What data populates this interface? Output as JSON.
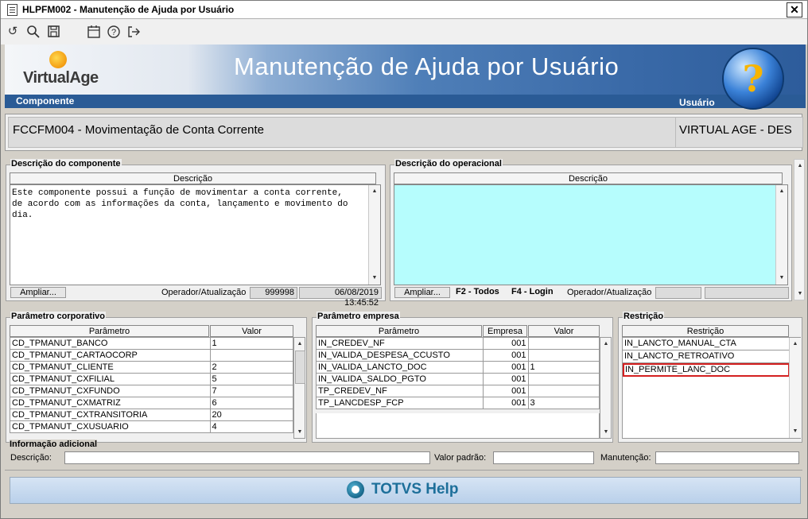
{
  "window": {
    "title": "HLPFM002 - Manutenção de Ajuda por Usuário",
    "close": "✕"
  },
  "toolbar": {
    "icons": [
      "undo-icon",
      "search-icon",
      "save-icon",
      "calendar-icon",
      "help-icon",
      "exit-icon"
    ]
  },
  "banner": {
    "logo_text": "VirtualAge",
    "title": "Manutenção de Ajuda por Usuário",
    "left_label": "Componente",
    "right_label": "Usuário",
    "help_glyph": "?"
  },
  "component": {
    "name": "FCCFM004 - Movimentação de Conta Corrente",
    "user": "VIRTUAL AGE - DES"
  },
  "comp_desc": {
    "legend": "Descrição do componente",
    "header": "Descrição",
    "lines": [
      "Este componente possui a função de movimentar a conta corrente,",
      "de acordo com as informações da conta, lançamento e movimento do",
      "dia."
    ],
    "expand_button": "Ampliar...",
    "operator_label": "Operador/Atualização",
    "operator": "999998",
    "updated": "06/08/2019 13:45:52"
  },
  "op_desc": {
    "legend": "Descrição do operacional",
    "header": "Descrição",
    "expand_button": "Ampliar...",
    "f2": "F2 - Todos",
    "f4": "F4 - Login",
    "operator_label": "Operador/Atualização",
    "operator": "",
    "updated": ""
  },
  "corp_params": {
    "legend": "Parâmetro corporativo",
    "headers": [
      "Parâmetro",
      "Valor"
    ],
    "rows": [
      [
        "CD_TPMANUT_BANCO",
        "1"
      ],
      [
        "CD_TPMANUT_CARTAOCORP",
        ""
      ],
      [
        "CD_TPMANUT_CLIENTE",
        "2"
      ],
      [
        "CD_TPMANUT_CXFILIAL",
        "5"
      ],
      [
        "CD_TPMANUT_CXFUNDO",
        "7"
      ],
      [
        "CD_TPMANUT_CXMATRIZ",
        "6"
      ],
      [
        "CD_TPMANUT_CXTRANSITORIA",
        "20"
      ],
      [
        "CD_TPMANUT_CXUSUARIO",
        "4"
      ]
    ]
  },
  "company_params": {
    "legend": "Parâmetro empresa",
    "headers": [
      "Parâmetro",
      "Empresa",
      "Valor"
    ],
    "rows": [
      [
        "IN_CREDEV_NF",
        "001",
        ""
      ],
      [
        "IN_VALIDA_DESPESA_CCUSTO",
        "001",
        ""
      ],
      [
        "IN_VALIDA_LANCTO_DOC",
        "001",
        "1"
      ],
      [
        "IN_VALIDA_SALDO_PGTO",
        "001",
        ""
      ],
      [
        "TP_CREDEV_NF",
        "001",
        ""
      ],
      [
        "TP_LANCDESP_FCP",
        "001",
        "3"
      ]
    ]
  },
  "restrictions": {
    "legend": "Restrição",
    "header": "Restrição",
    "rows": [
      "IN_LANCTO_MANUAL_CTA",
      "IN_LANCTO_RETROATIVO",
      "IN_PERMITE_LANC_DOC"
    ],
    "highlight_color": "#d42020"
  },
  "additional": {
    "legend": "Informação adicional",
    "desc_label": "Descrição:",
    "default_label": "Valor padrão:",
    "maint_label": "Manutenção:"
  },
  "help_bar": {
    "text": "TOTVS Help"
  },
  "colors": {
    "cyan": "#b6fdfd",
    "banner_strip": "#2a5b96"
  }
}
